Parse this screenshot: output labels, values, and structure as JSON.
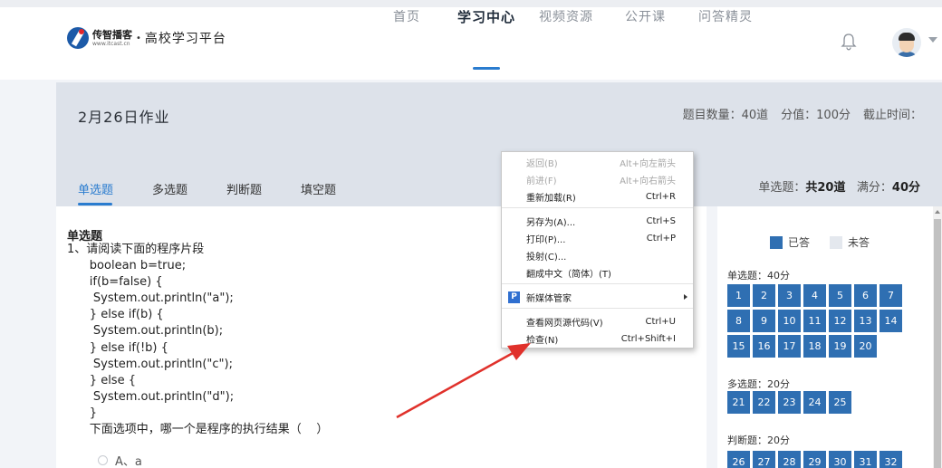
{
  "brand": {
    "name": "传智播客",
    "url": "www.itcast.cn",
    "separator": "•",
    "platform": "高校学习平台"
  },
  "nav": [
    {
      "label": "首页",
      "active": false
    },
    {
      "label": "学习中心",
      "active": true
    },
    {
      "label": "视频资源",
      "active": false
    },
    {
      "label": "公开课",
      "active": false
    },
    {
      "label": "问答精灵",
      "active": false
    }
  ],
  "homework": {
    "title": "2月26日作业",
    "question_count": "题目数量：40道",
    "score": "分值：100分",
    "deadline": "截止时间："
  },
  "tabs": [
    "单选题",
    "多选题",
    "判断题",
    "填空题"
  ],
  "summary": {
    "label": "单选题：",
    "count": "共20道",
    "full_label": "满分：",
    "full_value": "40分"
  },
  "question": {
    "type": "单选题",
    "lines": [
      "1、请阅读下面的程序片段",
      "      boolean b=true;",
      "      if(b=false) {",
      "       System.out.println(\"a\");",
      "      } else if(b) {",
      "       System.out.println(b);",
      "      } else if(!b) {",
      "       System.out.println(\"c\");",
      "      } else {",
      "       System.out.println(\"d\");",
      "      }",
      "      下面选项中，哪一个是程序的执行结果（    ）"
    ],
    "option_a": "A、a"
  },
  "answer_card": {
    "legend_done": "已答",
    "legend_todo": "未答",
    "sections": [
      {
        "title": "单选题：40分",
        "numbers": [
          "1",
          "2",
          "3",
          "4",
          "5",
          "6",
          "7",
          "8",
          "9",
          "10",
          "11",
          "12",
          "13",
          "14",
          "15",
          "16",
          "17",
          "18",
          "19",
          "20"
        ]
      },
      {
        "title": "多选题：20分",
        "numbers": [
          "21",
          "22",
          "23",
          "24",
          "25"
        ]
      },
      {
        "title": "判断题：20分",
        "numbers": [
          "26",
          "27",
          "28",
          "29",
          "30",
          "31",
          "32"
        ]
      }
    ]
  },
  "context_menu": {
    "groups": [
      [
        {
          "label": "返回(B)",
          "shortcut": "Alt+向左箭头",
          "disabled": true
        },
        {
          "label": "前进(F)",
          "shortcut": "Alt+向右箭头",
          "disabled": true
        },
        {
          "label": "重新加载(R)",
          "shortcut": "Ctrl+R",
          "disabled": false
        }
      ],
      [
        {
          "label": "另存为(A)...",
          "shortcut": "Ctrl+S",
          "disabled": false
        },
        {
          "label": "打印(P)...",
          "shortcut": "Ctrl+P",
          "disabled": false
        },
        {
          "label": "投射(C)...",
          "shortcut": "",
          "disabled": false
        },
        {
          "label": "翻成中文（简体）(T)",
          "shortcut": "",
          "disabled": false
        }
      ],
      [
        {
          "label": "新媒体管家",
          "shortcut": "",
          "disabled": false,
          "icon": "P",
          "submenu": true
        }
      ],
      [
        {
          "label": "查看网页源代码(V)",
          "shortcut": "Ctrl+U",
          "disabled": false
        },
        {
          "label": "检查(N)",
          "shortcut": "Ctrl+Shift+I",
          "disabled": false
        }
      ]
    ]
  },
  "colors": {
    "accent": "#2a7ccf",
    "answered": "#2f6fb2",
    "unanswered": "#e4e8ee",
    "annotation_arrow": "#e0312b"
  }
}
